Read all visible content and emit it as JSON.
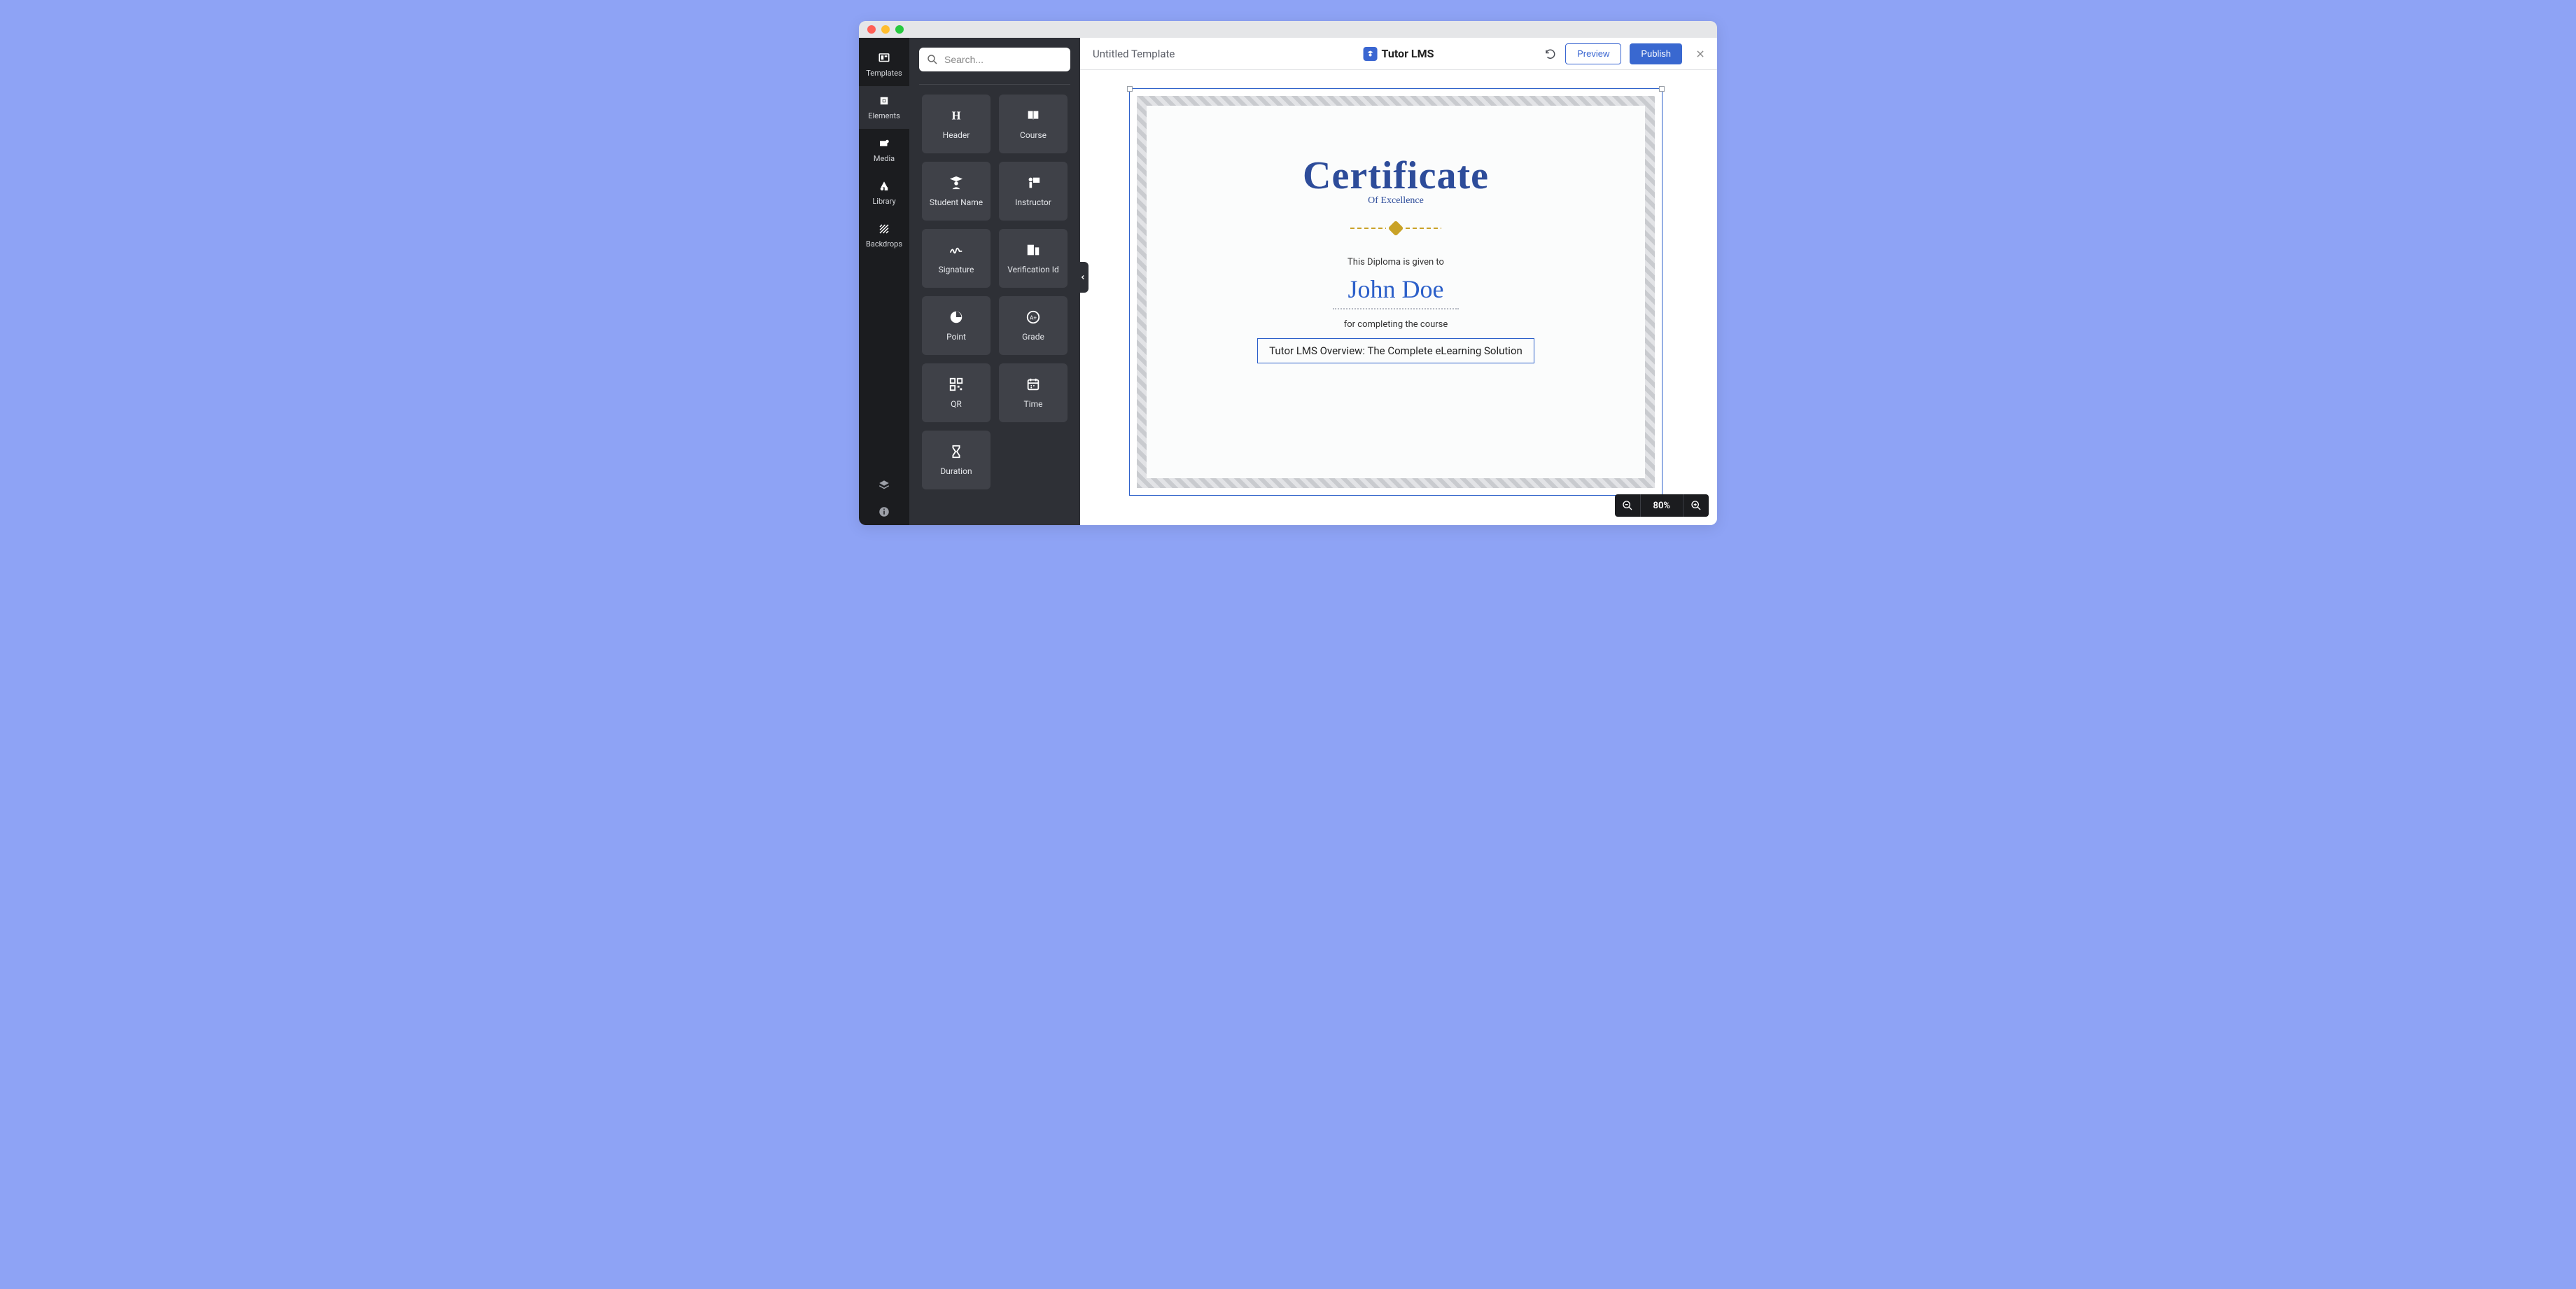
{
  "header": {
    "title": "Untitled Template",
    "brand": "Tutor LMS",
    "preview": "Preview",
    "publish": "Publish"
  },
  "search": {
    "placeholder": "Search..."
  },
  "nav": {
    "templates": "Templates",
    "elements": "Elements",
    "media": "Media",
    "library": "Library",
    "backdrops": "Backdrops"
  },
  "elements": {
    "header": "Header",
    "course": "Course",
    "student_name": "Student Name",
    "instructor": "Instructor",
    "signature": "Signature",
    "verification_id": "Verification Id",
    "point": "Point",
    "grade": "Grade",
    "qr": "QR",
    "time": "Time",
    "duration": "Duration"
  },
  "certificate": {
    "title": "Certificate",
    "subtitle": "Of Excellence",
    "given_to": "This Diploma is given to",
    "name": "John Doe",
    "for_completing": "for completing the course",
    "course_title": "Tutor LMS Overview: The Complete eLearning Solution"
  },
  "zoom": {
    "level": "80%"
  }
}
